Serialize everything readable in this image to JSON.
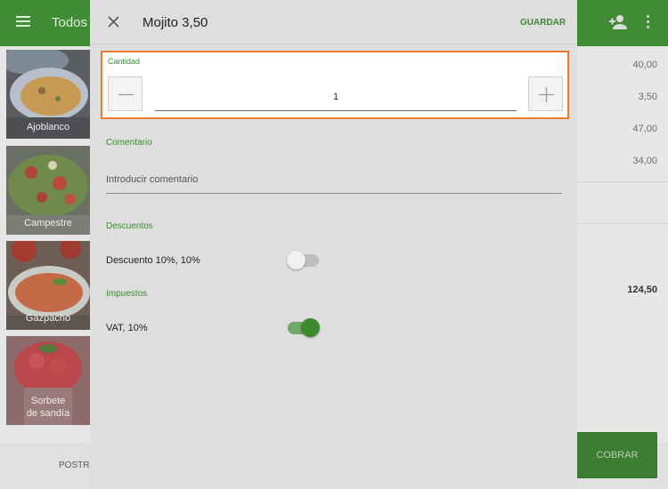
{
  "app": {
    "category_title": "Todos",
    "icons": {
      "menu": "menu-icon",
      "add_customer": "add-user-icon",
      "more": "more-vertical-icon"
    }
  },
  "products": [
    {
      "name": "Ajoblanco"
    },
    {
      "name": "Campestre"
    },
    {
      "name": "Gazpacho"
    },
    {
      "name": "Sorbete\nde sandía"
    }
  ],
  "ticket": {
    "prices": [
      "40,00",
      "3,50",
      "47,00",
      "34,00"
    ],
    "total": "124,50"
  },
  "bottom": {
    "postpone_label": "POSTR",
    "charge_label": "COBRAR"
  },
  "dialog": {
    "title": "Mojito 3,50",
    "save_label": "GUARDAR",
    "quantity": {
      "label": "Cantidad",
      "value": "1"
    },
    "comment": {
      "label": "Comentario",
      "placeholder": "Introducir comentario"
    },
    "discounts": {
      "label": "Descuentos",
      "items": [
        {
          "name": "Descuento 10%, 10%",
          "enabled": false
        }
      ]
    },
    "taxes": {
      "label": "Impuestos",
      "items": [
        {
          "name": "VAT, 10%",
          "enabled": true
        }
      ]
    }
  },
  "colors": {
    "accent": "#3a8a2f",
    "app_bar": "#3f8c34",
    "highlight": "#ec7b2f"
  }
}
